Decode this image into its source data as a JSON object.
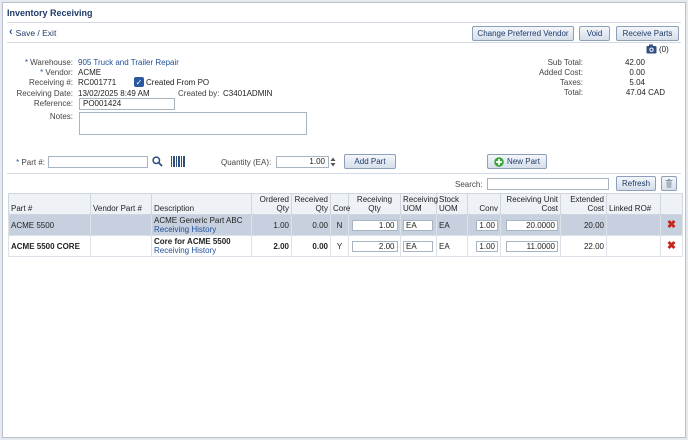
{
  "page_title": "Inventory Receiving",
  "toolbar": {
    "save_exit": "Save / Exit",
    "change_vendor": "Change Preferred Vendor",
    "void": "Void",
    "receive_parts": "Receive Parts",
    "attachments_count": "(0)"
  },
  "header": {
    "warehouse_label": "Warehouse:",
    "warehouse": "905 Truck and Trailer Repair",
    "vendor_label": "Vendor:",
    "vendor": "ACME",
    "receiving_no_label": "Receiving #:",
    "receiving_no": "RC001771",
    "created_from_po": "Created From PO",
    "receiving_date_label": "Receiving Date:",
    "receiving_date": "13/02/2025 8:49 AM",
    "created_by_label": "Created by:",
    "created_by": "C3401ADMIN",
    "reference_label": "Reference:",
    "reference": "PO001424",
    "notes_label": "Notes:",
    "notes": ""
  },
  "totals": {
    "sub_total_label": "Sub Total:",
    "sub_total": "42.00",
    "added_cost_label": "Added Cost:",
    "added_cost": "0.00",
    "taxes_label": "Taxes:",
    "taxes": "5.04",
    "total_label": "Total:",
    "total": "47.04 CAD"
  },
  "add_part": {
    "part_label": "Part #:",
    "part_value": "",
    "qty_label": "Quantity (EA):",
    "qty_value": "1.00",
    "add_button": "Add Part",
    "new_part_button": "New Part"
  },
  "grid_tools": {
    "search_label": "Search:",
    "search_value": "",
    "refresh": "Refresh"
  },
  "columns": [
    "Part #",
    "Vendor Part #",
    "Description",
    "Ordered Qty",
    "Received Qty",
    "Core",
    "Receiving Qty",
    "Receiving UOM",
    "Stock UOM",
    "Conv",
    "Receiving Unit Cost",
    "Extended Cost",
    "Linked RO#"
  ],
  "rows": [
    {
      "part": "ACME 5500",
      "vendor_part": "",
      "description": "ACME Generic Part ABC",
      "history": "Receiving History",
      "ordered": "1.00",
      "received": "0.00",
      "core": "N",
      "recv_qty": "1.00",
      "recv_uom": "EA",
      "stock_uom": "EA",
      "conv": "1.00",
      "unit_cost": "20.0000",
      "extended": "20.00",
      "linked_ro": ""
    },
    {
      "part": "ACME 5500 CORE",
      "vendor_part": "",
      "description": "Core for ACME 5500",
      "history": "Receiving History",
      "ordered": "2.00",
      "received": "0.00",
      "core": "Y",
      "recv_qty": "2.00",
      "recv_uom": "EA",
      "stock_uom": "EA",
      "conv": "1.00",
      "unit_cost": "11.0000",
      "extended": "22.00",
      "linked_ro": ""
    }
  ],
  "colors": {
    "accent": "#1f3a68",
    "link": "#1f4e9a",
    "selected_row": "#c7d0de",
    "delete": "#c8261c",
    "new_part_plus": "#3aa63a"
  }
}
